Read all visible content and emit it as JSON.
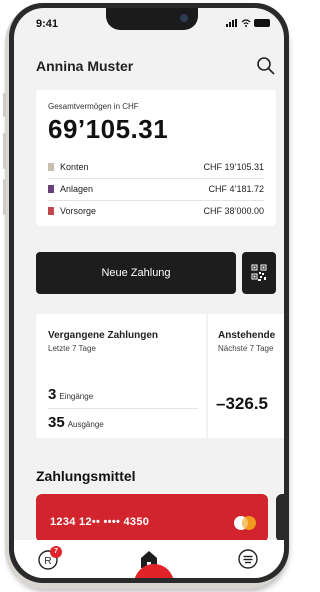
{
  "status_bar": {
    "time": "9:41"
  },
  "header": {
    "user_name": "Annina Muster"
  },
  "assets": {
    "label": "Gesamtvermögen in CHF",
    "total": "69’105.31",
    "rows": [
      {
        "name": "Konten",
        "amount": "CHF 19’105.31",
        "color": "#c9bdb0"
      },
      {
        "name": "Anlagen",
        "amount": "CHF 4’181.72",
        "color": "#6b3f7a"
      },
      {
        "name": "Vorsorge",
        "amount": "CHF 38’000.00",
        "color": "#c2464c"
      }
    ]
  },
  "actions": {
    "new_payment_label": "Neue Zahlung"
  },
  "past_payments": {
    "title": "Vergangene Zahlungen",
    "subtitle": "Letzte 7 Tage",
    "incoming_count": "3",
    "incoming_label": "Eingänge",
    "outgoing_count": "35",
    "outgoing_label": "Ausgänge"
  },
  "upcoming_payments": {
    "title": "Anstehende",
    "subtitle": "Nächste 7 Tage",
    "amount": "–326.5"
  },
  "payment_methods": {
    "title": "Zahlungsmittel",
    "card_number": "1234 12•• •••• 4350"
  },
  "bottom_nav": {
    "badge_count": "7"
  },
  "colors": {
    "accent": "#e2232a",
    "card_red": "#d2242c",
    "dark": "#1d1d1d"
  }
}
